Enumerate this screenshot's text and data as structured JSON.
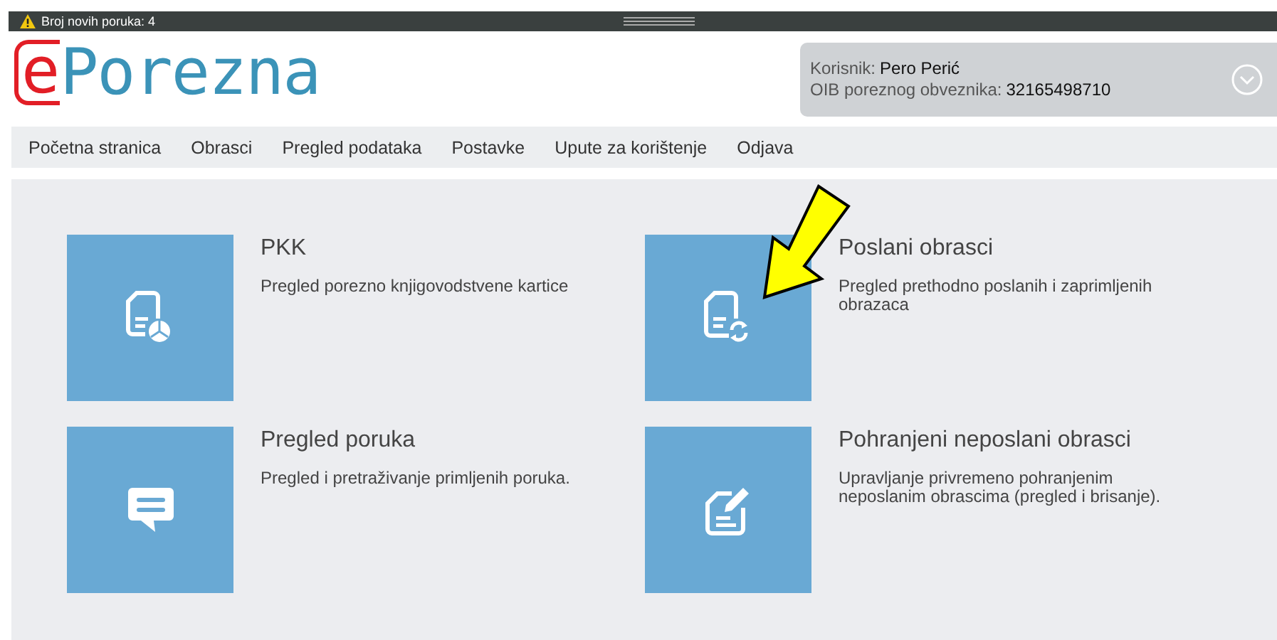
{
  "notice_bar": {
    "text": "Broj novih poruka: 4"
  },
  "logo": {
    "prefix": "e",
    "name": "Porezna"
  },
  "user_panel": {
    "user_label": "Korisnik:",
    "user_name": "Pero Perić",
    "oib_label": "OIB poreznog obveznika:",
    "oib": "32165498710"
  },
  "nav": [
    {
      "label": "Početna stranica"
    },
    {
      "label": "Obrasci"
    },
    {
      "label": "Pregled podataka"
    },
    {
      "label": "Postavke"
    },
    {
      "label": "Upute za korištenje"
    },
    {
      "label": "Odjava"
    }
  ],
  "tiles": [
    {
      "kind": "chart-document",
      "title": "PKK",
      "description": "Pregled porezno knjigovodstvene kartice",
      "highlighted": false
    },
    {
      "kind": "sync-document",
      "title": "Poslani obrasci",
      "description": "Pregled prethodno poslanih i zaprimljenih obrazaca",
      "highlighted": true
    },
    {
      "kind": "message",
      "title": "Pregled poruka",
      "description": "Pregled i pretraživanje primljenih poruka.",
      "highlighted": false
    },
    {
      "kind": "edit-document",
      "title": "Pohranjeni neposlani obrasci",
      "description": "Upravljanje privremeno pohranjenim neposlanim obrascima (pregled i brisanje).",
      "highlighted": false
    }
  ]
}
